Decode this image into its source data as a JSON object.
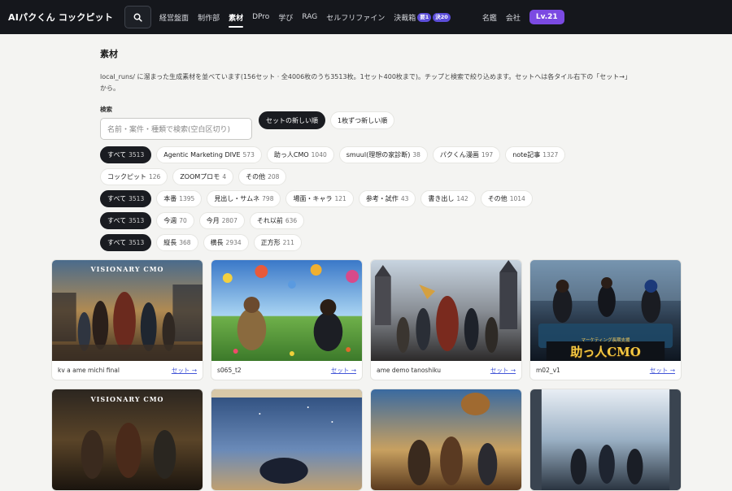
{
  "header": {
    "brand": "AIパクくん コックピット",
    "nav": [
      {
        "label": "経営盤面",
        "active": false
      },
      {
        "label": "制作部",
        "active": false
      },
      {
        "label": "素材",
        "active": true
      },
      {
        "label": "DPro",
        "active": false
      },
      {
        "label": "学び",
        "active": false
      },
      {
        "label": "RAG",
        "active": false
      },
      {
        "label": "セルフリファイン",
        "active": false
      }
    ],
    "decision": {
      "label": "決裁箱",
      "badge1": "要1",
      "badge2": "決20"
    },
    "nav_right": [
      {
        "label": "名鑑"
      },
      {
        "label": "会社"
      }
    ],
    "level": "Lv.21"
  },
  "page": {
    "title": "素材",
    "description": "local_runs/ に溜まった生成素材を並べています(156セット · 全4006枚のうち3513枚。1セット400枚まで)。チップと検索で絞り込めます。セットへは各タイル右下の「セット→」から。"
  },
  "search": {
    "label": "検索",
    "placeholder": "名前・案件・種類で検索(空白区切り)",
    "sort": [
      {
        "label": "セットの新しい順",
        "active": true
      },
      {
        "label": "1枚ずつ新しい順",
        "active": false
      }
    ]
  },
  "filters": {
    "project": [
      {
        "label": "すべて",
        "count": "3513",
        "active": true
      },
      {
        "label": "Agentic Marketing DIVE",
        "count": "573"
      },
      {
        "label": "助っ人CMO",
        "count": "1040"
      },
      {
        "label": "smuul(理想の家診断)",
        "count": "38"
      },
      {
        "label": "パクくん漫画",
        "count": "197"
      },
      {
        "label": "note記事",
        "count": "1327"
      },
      {
        "label": "コックピット",
        "count": "126"
      },
      {
        "label": "ZOOMプロモ",
        "count": "4"
      },
      {
        "label": "その他",
        "count": "208"
      }
    ],
    "kind": [
      {
        "label": "すべて",
        "count": "3513",
        "active": true
      },
      {
        "label": "本番",
        "count": "1395"
      },
      {
        "label": "見出し・サムネ",
        "count": "798"
      },
      {
        "label": "場面・キャラ",
        "count": "121"
      },
      {
        "label": "参考・試作",
        "count": "43"
      },
      {
        "label": "書き出し",
        "count": "142"
      },
      {
        "label": "その他",
        "count": "1014"
      }
    ],
    "period": [
      {
        "label": "すべて",
        "count": "3513",
        "active": true
      },
      {
        "label": "今週",
        "count": "70"
      },
      {
        "label": "今月",
        "count": "2807"
      },
      {
        "label": "それ以前",
        "count": "636"
      }
    ],
    "shape": [
      {
        "label": "すべて",
        "count": "3513",
        "active": true
      },
      {
        "label": "縦長",
        "count": "368"
      },
      {
        "label": "横長",
        "count": "2934"
      },
      {
        "label": "正方形",
        "count": "211"
      }
    ]
  },
  "cards": [
    {
      "name": "kv a ame michi final",
      "link": "セット →",
      "overlay": "VISIONARY CMO"
    },
    {
      "name": "s065_t2",
      "link": "セット →",
      "overlay": ""
    },
    {
      "name": "ame demo tanoshiku",
      "link": "セット →",
      "overlay": ""
    },
    {
      "name": "m02_v1",
      "link": "セット →",
      "overlay": "助っ人CMO",
      "overlay_sub": "マーケティング長期支援"
    },
    {
      "name": "",
      "link": "",
      "overlay": "VISIONARY CMO"
    },
    {
      "name": "",
      "link": "",
      "overlay": ""
    },
    {
      "name": "",
      "link": "",
      "overlay": ""
    },
    {
      "name": "",
      "link": "",
      "overlay": ""
    }
  ]
}
